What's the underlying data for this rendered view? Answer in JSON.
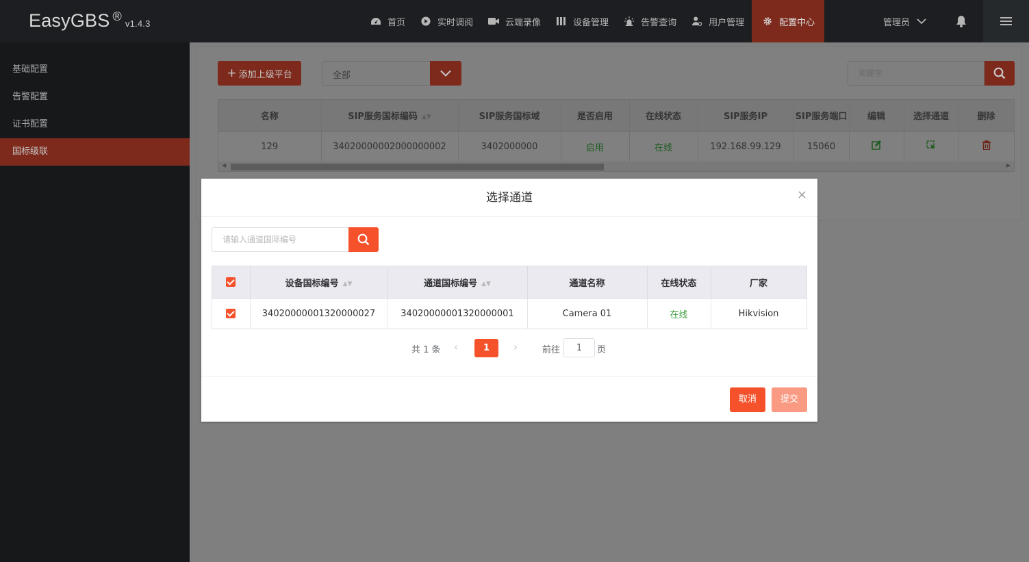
{
  "app": {
    "logo_text": "EasyGBS",
    "logo_reg": "®",
    "version": "v1.4.3"
  },
  "nav": {
    "items": [
      {
        "label": "首页",
        "icon": "dashboard-icon"
      },
      {
        "label": "实时调阅",
        "icon": "play-circle-icon"
      },
      {
        "label": "云端录像",
        "icon": "video-camera-icon"
      },
      {
        "label": "设备管理",
        "icon": "device-bars-icon"
      },
      {
        "label": "告警查询",
        "icon": "alarm-light-icon"
      },
      {
        "label": "用户管理",
        "icon": "user-gear-icon"
      },
      {
        "label": "配置中心",
        "icon": "gear-icon",
        "active": true
      }
    ],
    "user": "管理员"
  },
  "sidebar": {
    "items": [
      {
        "label": "基础配置"
      },
      {
        "label": "告警配置"
      },
      {
        "label": "证书配置"
      },
      {
        "label": "国标级联",
        "active": true
      }
    ]
  },
  "toolbar": {
    "add_label": "添加上级平台",
    "filter_value": "全部",
    "keyword_placeholder": "关键字"
  },
  "platform_table": {
    "headers": [
      "名称",
      "SIP服务国标编码",
      "SIP服务国标域",
      "是否启用",
      "在线状态",
      "SIP服务IP",
      "SIP服务端口",
      "编辑",
      "选择通道",
      "删除"
    ],
    "rows": [
      {
        "name": "129",
        "sip_code": "34020000002000000002",
        "sip_domain": "3402000000",
        "enabled": "启用",
        "online": "在线",
        "sip_ip": "192.168.99.129",
        "sip_port": "15060"
      }
    ]
  },
  "dialog": {
    "title": "选择通道",
    "close": "×",
    "search_placeholder": "请输入通道国际编号",
    "headers": [
      "设备国标编号",
      "通道国标编号",
      "通道名称",
      "在线状态",
      "厂家"
    ],
    "rows": [
      {
        "device_id": "34020000001320000027",
        "channel_id": "34020000001320000001",
        "channel_name": "Camera 01",
        "status": "在线",
        "vendor": "Hikvision",
        "checked": true
      }
    ],
    "pagination": {
      "total": "共 1 条",
      "current": "1",
      "goto": "前往",
      "goto_value": "1",
      "page_suffix": "页"
    },
    "cancel_label": "取消",
    "submit_label": "提交"
  },
  "colors": {
    "accent": "#f5522c",
    "accent_light": "#fa9a83",
    "online_green": "#3a9b3a",
    "topbar_bg": "#1c1e21",
    "sidebar_bg": "#16181a"
  }
}
